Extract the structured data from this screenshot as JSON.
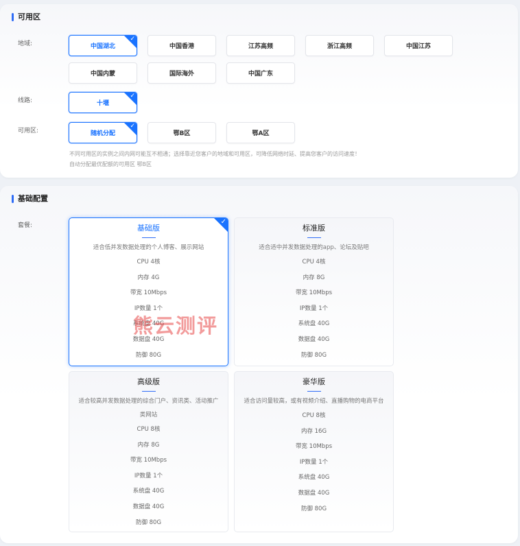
{
  "availability": {
    "title": "可用区",
    "region_label": "地域:",
    "regions": [
      "中国湖北",
      "中国香港",
      "江苏高频",
      "浙江高频",
      "中国江苏",
      "中国内蒙",
      "国际海外",
      "中国广东"
    ],
    "line_label": "线路:",
    "lines": [
      "十堰"
    ],
    "zone_label": "可用区:",
    "zones": [
      "随机分配",
      "鄂B区",
      "鄂A区"
    ],
    "hint_1": "不同可用区的实例之间内网可能互不相通；选择靠近您客户的地域和可用区，可降低网络时延、提高您客户的访问速度！",
    "hint_2": "自动分配最优配额的可用区 鄂B区",
    "check_glyph": "✓"
  },
  "base": {
    "title": "基础配置",
    "plan_label": "套餐:",
    "plans": [
      {
        "name": "基础版",
        "desc": "适合低并发数据处理的个人博客、展示网站",
        "specs": [
          "CPU 4核",
          "内存 4G",
          "带宽 10Mbps",
          "IP数量 1个",
          "系统盘 40G",
          "数据盘 40G",
          "防御 80G"
        ]
      },
      {
        "name": "标准版",
        "desc": "适合适中并发数据处理的app、论坛及贴吧",
        "specs": [
          "CPU 4核",
          "内存 8G",
          "带宽 10Mbps",
          "IP数量 1个",
          "系统盘 40G",
          "数据盘 40G",
          "防御 80G"
        ]
      },
      {
        "name": "高级版",
        "desc": "适合较高并发数据处理的综合门户、资讯类、活动推广类网站",
        "specs": [
          "CPU 8核",
          "内存 8G",
          "带宽 10Mbps",
          "IP数量 1个",
          "系统盘 40G",
          "数据盘 40G",
          "防御 80G"
        ]
      },
      {
        "name": "豪华版",
        "desc": "适合访问量较高，或有视频介绍、直播购物的电商平台",
        "specs": [
          "CPU 8核",
          "内存 16G",
          "带宽 10Mbps",
          "IP数量 1个",
          "系统盘 40G",
          "数据盘 40G",
          "防御 80G"
        ]
      }
    ]
  },
  "watermark": "熊云测评",
  "colors": {
    "accent": "#1a73ff",
    "watermark": "#e84949"
  }
}
